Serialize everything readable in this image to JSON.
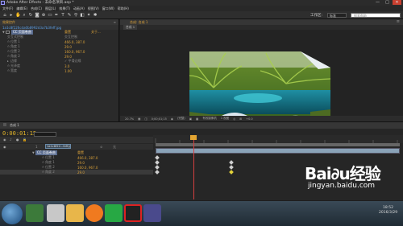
{
  "titlebar": {
    "title": "Adobe After Effects - 未命名项目.aep *",
    "minimize": "—",
    "maximize": "□",
    "close": "✕"
  },
  "menu": [
    "文件(F)",
    "编辑(E)",
    "合成(C)",
    "图层(L)",
    "效果(T)",
    "动画(A)",
    "视图(V)",
    "窗口(W)",
    "帮助(H)"
  ],
  "toolbar": {
    "workspace_label": "工作区:",
    "workspace_value": "标准",
    "search_placeholder": "搜索帮助"
  },
  "effect_controls": {
    "tab": "效果控件",
    "layer_path": "1a1c8f226cda0b8992d3a7b3feff.jpg",
    "header_reset": "重置",
    "header_about": "关于...",
    "effect_name": "CC 页面卷曲",
    "props": [
      {
        "name": "交互式控制",
        "value": "",
        "type": "checkbox"
      },
      {
        "name": "位置 1",
        "value": "466.0, 387.0"
      },
      {
        "name": "角度 1",
        "value": "29.0"
      },
      {
        "name": "位置 2",
        "value": "160.0, 967.0"
      },
      {
        "name": "角度 2",
        "value": "29.0"
      },
      {
        "name": "边缘",
        "value": "平滑边缘",
        "type": "checkbox"
      },
      {
        "name": "光泽度",
        "value": "3.0"
      },
      {
        "name": "宽度",
        "value": "1.00"
      }
    ]
  },
  "composition": {
    "tab": "合成: 合成 1",
    "sub_tab": "合成 1",
    "footer": {
      "zoom": "20.7%",
      "timecode": "0;00;01;15",
      "quality": "(完整)",
      "camera": "有效摄像机",
      "views": "1 视图",
      "offset": "+0.0"
    }
  },
  "timeline": {
    "tab": "合成 1",
    "time": "0:00:01:15",
    "layer": {
      "index": "1",
      "name": "1a1c8f22...feff.jpg",
      "mode": "无"
    },
    "props": [
      {
        "name": "CC 页面卷曲",
        "value": "重置"
      },
      {
        "name": "位置 1",
        "value": "466.0, 387.0"
      },
      {
        "name": "角度 1",
        "value": "29.0"
      },
      {
        "name": "位置 2",
        "value": "160.0, 967.0"
      },
      {
        "name": "角度 2",
        "value": "29.0"
      }
    ]
  },
  "taskbar": {
    "time": "18:52",
    "date": "2016/3/29"
  },
  "watermark": {
    "brand": "Bai∂u经验",
    "url": "jingyan.baidu.com"
  }
}
